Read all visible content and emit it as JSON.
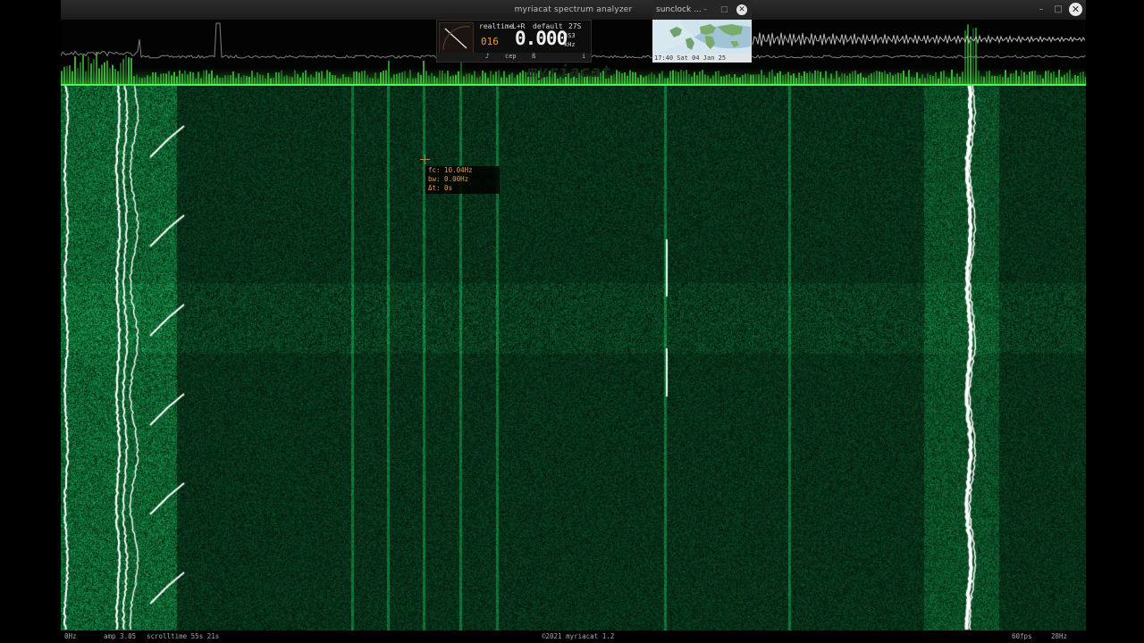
{
  "app": {
    "title": "myriacat spectrum analyzer",
    "close_glyph": "✕",
    "minimize_glyph": "–",
    "maximize_glyph": "□"
  },
  "panel": {
    "mode": "realtime",
    "channel": "L+R",
    "preset": "default",
    "value_27": "27S",
    "left_digits": "016",
    "big_value": "0.000",
    "unit_top": "4S3",
    "unit_bottom": "kHz",
    "buttons": [
      "♪",
      "cep",
      "ß"
    ],
    "info": "i"
  },
  "sunclock": {
    "title": "sunclock ...",
    "time": "17:40 Sat 04 Jan 25"
  },
  "watermark": "myriacat",
  "tooltip": {
    "fc": "fc: 10.04Hz",
    "bw": "bw: 0.00Hz",
    "dt": "Δt: 0s"
  },
  "status": {
    "left_freq": "0Hz",
    "amp": "amp 3.05",
    "scrolltime": "scrolltime 55s 21s",
    "copyright": "©2021 myriacat 1.2",
    "fps": "60fps",
    "right_freq": "28Hz"
  },
  "colors": {
    "waterfall_dark": "#03140b",
    "waterfall_green": "#1f9a4f",
    "trace_white": "#ffffff",
    "accent_orange": "#f09a2a",
    "tooltip_text": "#e29a55"
  }
}
